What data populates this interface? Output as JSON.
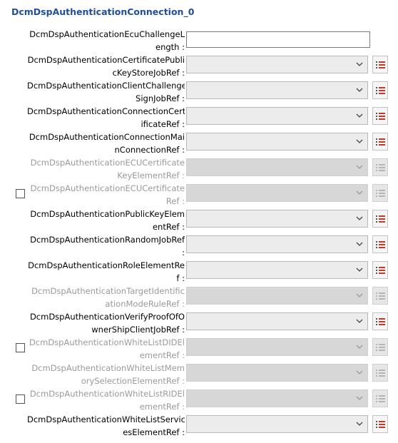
{
  "title": "DcmDspAuthenticationConnection_0",
  "rows": [
    {
      "l1": "DcmDspAuthenticationEcuChallengeL",
      "l2": "ength :",
      "type": "text",
      "value": "",
      "disabled": false,
      "checkbox": false
    },
    {
      "l1": "DcmDspAuthenticationCertificatePubli",
      "l2": "cKeyStoreJobRef :",
      "type": "combo",
      "disabled": false,
      "checkbox": false
    },
    {
      "l1": "DcmDspAuthenticationClientChallenge",
      "l2": "SignJobRef :",
      "type": "combo",
      "disabled": false,
      "checkbox": false
    },
    {
      "l1": "DcmDspAuthenticationConnectionCert",
      "l2": "ificateRef :",
      "type": "combo",
      "disabled": false,
      "checkbox": false
    },
    {
      "l1": "DcmDspAuthenticationConnectionMai",
      "l2": "nConnectionRef :",
      "type": "combo",
      "disabled": false,
      "checkbox": false
    },
    {
      "l1": "DcmDspAuthenticationECUCertificate",
      "l2": "KeyElementRef :",
      "type": "combo",
      "disabled": true,
      "checkbox": false
    },
    {
      "l1": "DcmDspAuthenticationECUCertificate",
      "l2": "Ref :",
      "type": "combo",
      "disabled": true,
      "checkbox": true
    },
    {
      "l1": "DcmDspAuthenticationPublicKeyElem",
      "l2": "entRef :",
      "type": "combo",
      "disabled": false,
      "checkbox": false
    },
    {
      "l1": "DcmDspAuthenticationRandomJobRef",
      "l2": ":",
      "type": "combo",
      "disabled": false,
      "checkbox": false
    },
    {
      "l1": "DcmDspAuthenticationRoleElementRe",
      "l2": "f :",
      "type": "combo",
      "disabled": false,
      "checkbox": false
    },
    {
      "l1": "DcmDspAuthenticationTargetIdentific",
      "l2": "ationModeRuleRef :",
      "type": "combo",
      "disabled": true,
      "checkbox": false
    },
    {
      "l1": "DcmDspAuthenticationVerifyProofOfO",
      "l2": "wnerShipClientJobRef :",
      "type": "combo",
      "disabled": false,
      "checkbox": false
    },
    {
      "l1": "DcmDspAuthenticationWhiteListDIDEl",
      "l2": "ementRef :",
      "type": "combo",
      "disabled": true,
      "checkbox": true
    },
    {
      "l1": "DcmDspAuthenticationWhiteListMem",
      "l2": "orySelectionElementRef :",
      "type": "combo",
      "disabled": true,
      "checkbox": false
    },
    {
      "l1": "DcmDspAuthenticationWhiteListRIDEl",
      "l2": "ementRef :",
      "type": "combo",
      "disabled": true,
      "checkbox": true
    },
    {
      "l1": "DcmDspAuthenticationWhiteListServic",
      "l2": "esElementRef :",
      "type": "combo",
      "disabled": false,
      "checkbox": false
    }
  ],
  "icons": {
    "dropdown": "chevron-down-icon",
    "list": "list-icon"
  },
  "colors": {
    "title": "#1f4e9c",
    "list_icon": "#c0392b",
    "disabled_text": "#9a9a9a"
  }
}
